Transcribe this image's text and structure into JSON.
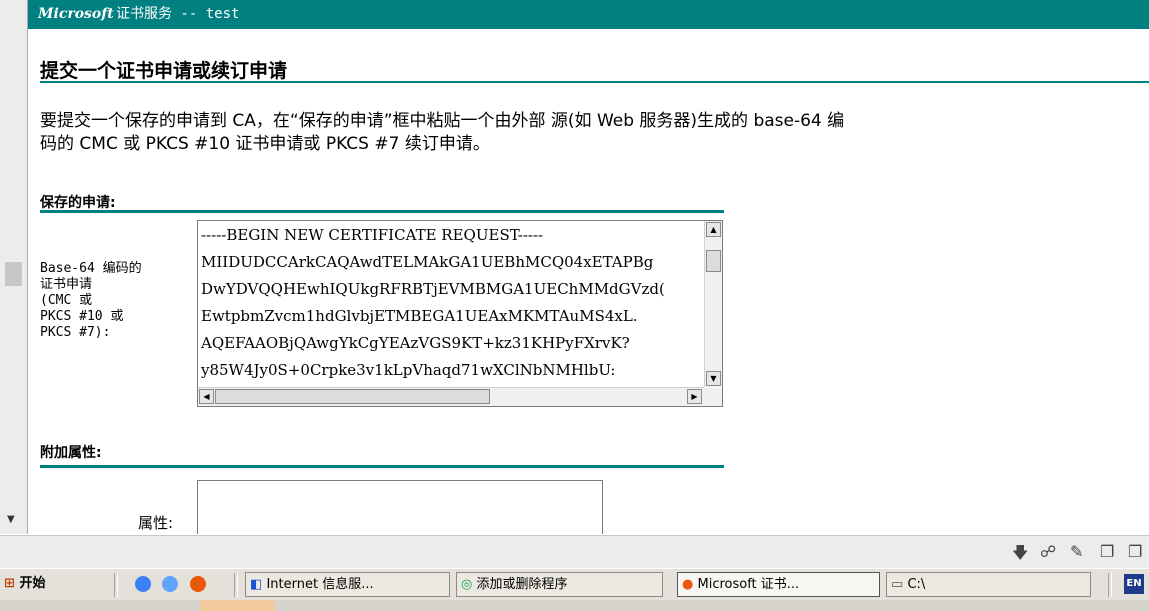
{
  "window": {
    "brand": "Microsoft",
    "header_rest": "证书服务 --  test"
  },
  "page": {
    "title": "提交一个证书申请或续订申请",
    "desc_line1": "要提交一个保存的申请到 CA，在“保存的申请”框中粘贴一个由外部 源(如 Web 服务器)生成的 base-64 编",
    "desc_line2": "码的 CMC 或 PKCS #10 证书申请或 PKCS #7 续订申请。"
  },
  "saved_request": {
    "section_title": "保存的申请:",
    "field_label": "Base-64 编码的\n证书申请\n(CMC 或\nPKCS #10 或\nPKCS #7):",
    "lines": [
      "-----BEGIN NEW CERTIFICATE REQUEST-----",
      "MIIDUDCCArkCAQAwdTELMAkGA1UEBhMCQ04xETAPBg",
      "DwYDVQQHEwhIQUkgRFRBTjEVMBMGA1UEChMMdGVzd(",
      "EwtpbmZvcm1hdGlvbjETMBEGA1UEAxMKMTAuMS4xL.",
      "AQEFAAOBjQAwgYkCgYEAzVGS9KT+kz31KHPyFXrvK?",
      "y85W4Jy0S+0Crpke3v1kLpVhaqd71wXClNbNMHlbU:"
    ]
  },
  "additional_attributes": {
    "section_title": "附加属性:",
    "attr_label": "属性:",
    "attr_value": ""
  },
  "taskbar": {
    "start_label": "开始",
    "tasks": [
      {
        "label": "Internet 信息服..."
      },
      {
        "label": "添加或删除程序"
      },
      {
        "label": "Microsoft 证书..."
      },
      {
        "label": "C:\\"
      }
    ],
    "tray_lang": "EN"
  },
  "colors": {
    "accent": "#008080",
    "taskbar": "#e4e1da"
  }
}
